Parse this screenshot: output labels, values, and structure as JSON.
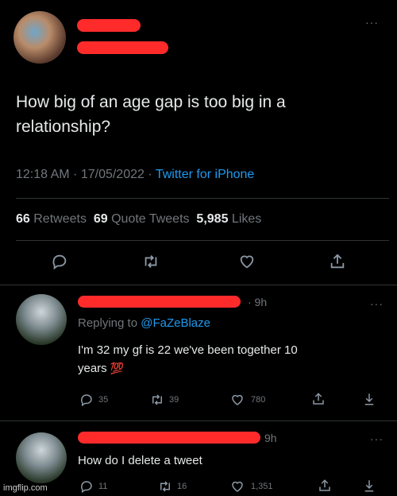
{
  "main_tweet": {
    "text": "How big of an age gap is too big in a relationship?",
    "time": "12:18 AM · 17/05/2022 · ",
    "source": "Twitter for iPhone",
    "stats": {
      "retweets_count": "66",
      "retweets_label": "Retweets",
      "quote_count": "69",
      "quote_label": "Quote Tweets",
      "likes_count": "5,985",
      "likes_label": "Likes"
    }
  },
  "replies": [
    {
      "age": "· 9h",
      "replying_label": "Replying to ",
      "replying_handle": "@FaZeBlaze",
      "text_line1": "I'm 32 my gf is 22 we've been together 10",
      "text_line2": "years",
      "emoji": "💯",
      "counts": {
        "reply": "35",
        "retweet": "39",
        "like": "780"
      }
    },
    {
      "age": "9h",
      "text": "How do I delete a tweet",
      "counts": {
        "reply": "11",
        "retweet": "16",
        "like": "1,351"
      }
    }
  ],
  "watermark": "imgflip.com",
  "colors": {
    "background": "#000000",
    "link": "#1d9bf0",
    "redaction": "#ff2b2b",
    "muted": "#71767b"
  }
}
